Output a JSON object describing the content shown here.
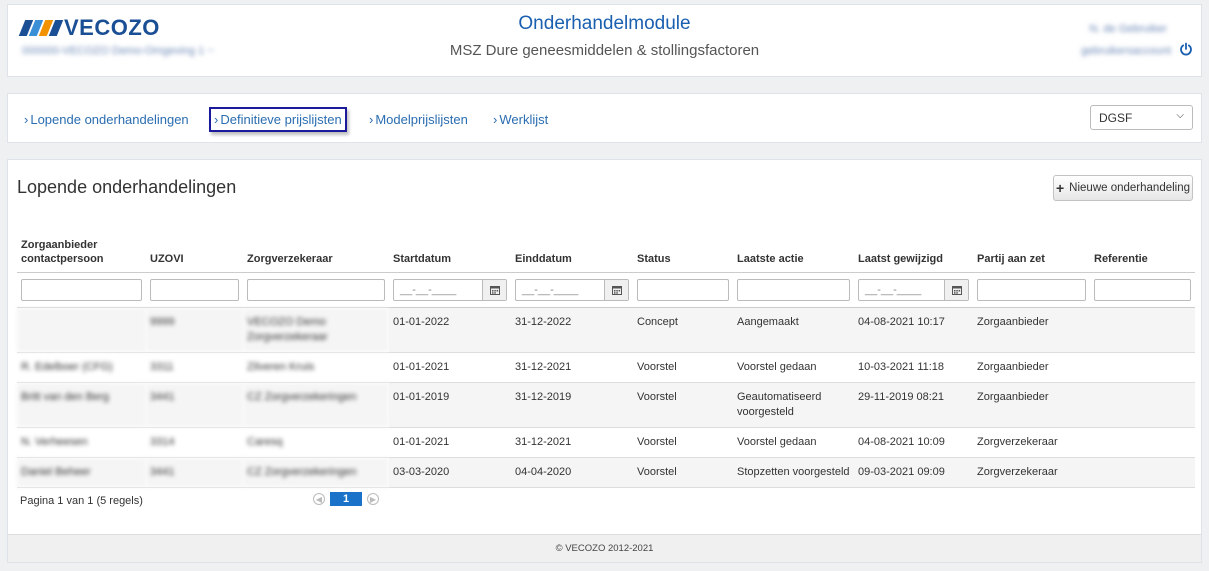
{
  "header": {
    "logo_text": "VECOZO",
    "org_line": "000000-VECOZO Demo-Omgeving 1 ~",
    "title": "Onderhandelmodule",
    "subtitle": "MSZ Dure geneesmiddelen & stollingsfactoren",
    "user_name": "N. de Gebruiker",
    "user_account": "gebruikersaccount",
    "colors": {
      "brand_blue": "#1a4f95",
      "orange": "#f39200",
      "light_blue": "#3b8fd6"
    }
  },
  "nav": {
    "items": [
      {
        "label": "Lopende onderhandelingen"
      },
      {
        "label": "Definitieve prijslijsten"
      },
      {
        "label": "Modelprijslijsten"
      },
      {
        "label": "Werklijst"
      }
    ],
    "select_value": "DGSF"
  },
  "main": {
    "title": "Lopende onderhandelingen",
    "new_button": "Nieuwe onderhandeling",
    "columns": [
      "Zorgaanbieder contactpersoon",
      "UZOVI",
      "Zorgverzekeraar",
      "Startdatum",
      "Einddatum",
      "Status",
      "Laatste actie",
      "Laatst gewijzigd",
      "Partij aan zet",
      "Referentie"
    ],
    "date_placeholder": "__-__-____",
    "rows": [
      {
        "contact": "",
        "uzovi": "9999",
        "verzekeraar": "VECOZO Demo Zorgverzekeraar",
        "start": "01-01-2022",
        "eind": "31-12-2022",
        "status": "Concept",
        "actie": "Aangemaakt",
        "gewijzigd": "04-08-2021 10:17",
        "partij": "Zorgaanbieder",
        "ref": ""
      },
      {
        "contact": "R. Edelboer (CFG)",
        "uzovi": "3311",
        "verzekeraar": "Zilveren Kruis",
        "start": "01-01-2021",
        "eind": "31-12-2021",
        "status": "Voorstel",
        "actie": "Voorstel gedaan",
        "gewijzigd": "10-03-2021 11:18",
        "partij": "Zorgaanbieder",
        "ref": ""
      },
      {
        "contact": "Britt van den Berg",
        "uzovi": "3441",
        "verzekeraar": "CZ Zorgverzekeringen",
        "start": "01-01-2019",
        "eind": "31-12-2019",
        "status": "Voorstel",
        "actie": "Geautomatiseerd voorgesteld",
        "gewijzigd": "29-11-2019 08:21",
        "partij": "Zorgaanbieder",
        "ref": ""
      },
      {
        "contact": "N. Verheesen",
        "uzovi": "3314",
        "verzekeraar": "Caresq",
        "start": "01-01-2021",
        "eind": "31-12-2021",
        "status": "Voorstel",
        "actie": "Voorstel gedaan",
        "gewijzigd": "04-08-2021 10:09",
        "partij": "Zorgverzekeraar",
        "ref": ""
      },
      {
        "contact": "Daniel Beheer",
        "uzovi": "3441",
        "verzekeraar": "CZ Zorgverzekeringen",
        "start": "03-03-2020",
        "eind": "04-04-2020",
        "status": "Voorstel",
        "actie": "Stopzetten voorgesteld",
        "gewijzigd": "09-03-2021 09:09",
        "partij": "Zorgverzekeraar",
        "ref": ""
      }
    ],
    "pager_text": "Pagina 1 van 1 (5 regels)",
    "page_number": "1",
    "footer": "© VECOZO 2012-2021"
  }
}
